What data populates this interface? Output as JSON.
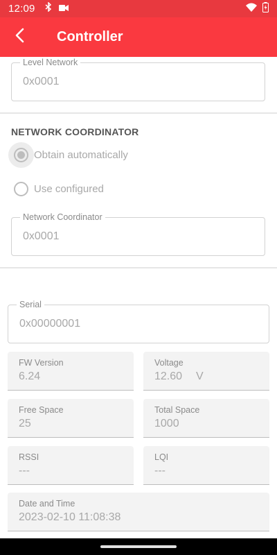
{
  "status_bar": {
    "time": "12:09",
    "icons": [
      "bluetooth-icon",
      "camera-icon",
      "wifi-icon",
      "battery-icon"
    ]
  },
  "app_bar": {
    "title": "Controller",
    "back_icon": "arrow-back-icon",
    "color": "#fa3940"
  },
  "level_network": {
    "label": "Level Network",
    "value": "0x0001"
  },
  "network_coordinator": {
    "section_title": "NETWORK COORDINATOR",
    "option_auto": "Obtain automatically",
    "option_configured": "Use configured",
    "selected": "Obtain automatically",
    "field_label": "Network Coordinator",
    "field_value": "0x0001"
  },
  "device_info": {
    "serial": {
      "label": "Serial",
      "value": "0x00000001"
    },
    "fw_version": {
      "label": "FW Version",
      "value": "6.24"
    },
    "voltage": {
      "label": "Voltage",
      "value": "12.60",
      "unit": "V"
    },
    "free_space": {
      "label": "Free Space",
      "value": "25"
    },
    "total_space": {
      "label": "Total Space",
      "value": "1000"
    },
    "rssi": {
      "label": "RSSI",
      "value": "---"
    },
    "lqi": {
      "label": "LQI",
      "value": "---"
    },
    "date_time": {
      "label": "Date and Time",
      "value": "2023-02-10 11:08:38"
    }
  }
}
